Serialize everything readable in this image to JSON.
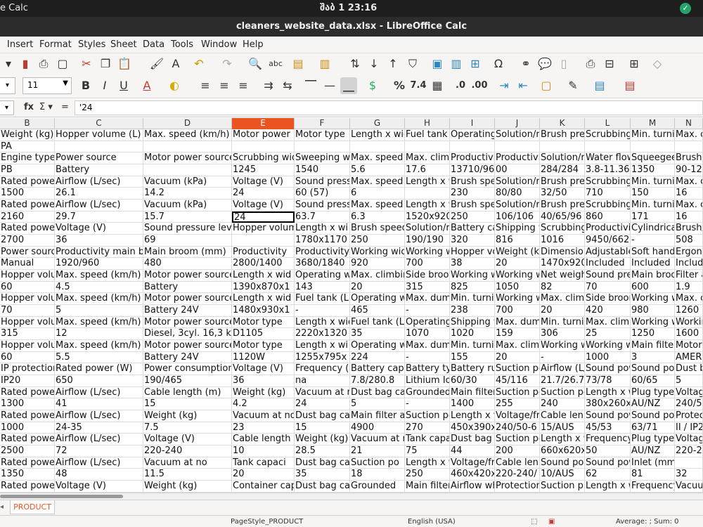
{
  "system": {
    "app_name": "e Calc",
    "clock": "შაბ 1  23:16"
  },
  "window": {
    "title": "cleaners_website_data.xlsx - LibreOffice Calc"
  },
  "menu": [
    "Insert",
    "Format",
    "Styles",
    "Sheet",
    "Data",
    "Tools",
    "Window",
    "Help"
  ],
  "toolbar": {
    "font_size": "11"
  },
  "formula": {
    "content": "'24"
  },
  "columns": [
    "B",
    "C",
    "D",
    "E",
    "F",
    "G",
    "H",
    "I",
    "J",
    "K",
    "L",
    "M",
    "N"
  ],
  "active_column": "E",
  "rows": [
    [
      "Weight (kg)",
      "Hopper volume (L)",
      "Max. speed (km/h)",
      "Motor power (",
      "Motor type",
      "Length x wid",
      "Fuel tank (L",
      "Operating w",
      "Solution/re",
      "Brush press",
      "Scrubbing w",
      "Min. turnin",
      "Max. c"
    ],
    [
      "PA",
      "",
      "",
      "",
      "",
      "",
      "",
      "",
      "",
      "",
      "",
      "",
      ""
    ],
    [
      "Engine type",
      "Power source",
      "Motor power source",
      "Scrubbing wid",
      "Sweeping wi",
      "Max. speed (",
      "Max. climb",
      "Productivity",
      "Productivity",
      "Solution/re",
      "Water flow",
      "Squeegee w",
      "Brush"
    ],
    [
      "PB",
      "Battery",
      "",
      "1245",
      "1540",
      "5.6",
      "17.6",
      "13710/9600",
      "00",
      "284/284",
      "3.8-11.36",
      "1350",
      "90-12"
    ],
    [
      "Rated power",
      "Airflow (L/sec)",
      "Vacuum (kPa)",
      "Voltage (V)",
      "Sound pressu",
      "Max. speed (",
      "Length x w",
      "Brush spe",
      "Solution/re",
      "Brush pre",
      "Scrubbing",
      "Min. turnin",
      "Max. c"
    ],
    [
      "1500",
      "26.1",
      "14.2",
      "24",
      "60 (57)",
      "6",
      "",
      "230",
      "80/80",
      "32/50",
      "710",
      "150",
      "16"
    ],
    [
      "Rated power",
      "Airflow (L/sec)",
      "Vacuum (kPa)",
      "Voltage (V)",
      "Sound pressu",
      "Max. speed (",
      "Length x w",
      "Brush spe",
      "Solution/re",
      "Brush pre",
      "Scrubbing",
      "Min. turnin",
      "Max. c"
    ],
    [
      "2160",
      "29.7",
      "15.7",
      "24",
      "63.7",
      "6.3",
      "1520x920",
      "250",
      "106/106",
      "40/65/96",
      "860",
      "171",
      "16"
    ],
    [
      "Rated power",
      "Voltage (V)",
      "Sound pressure lev",
      "Hopper volum",
      "Length x wi",
      "Brush speed",
      "Solution/re",
      "Battery cap",
      "Shipping w",
      "Scrubbing",
      "Productivity",
      "Cylindrical",
      "Brush/"
    ],
    [
      "2700",
      "36",
      "69",
      "",
      "1780x1170",
      "250",
      "190/190",
      "320",
      "816",
      "1016",
      "9450/6620",
      "-",
      "508"
    ],
    [
      "Power source",
      "Productivity main b",
      "Main broom (mm)",
      "Productivity",
      "Productivity",
      "Working wid",
      "Working w",
      "Hopper vo",
      "Weight (kg",
      "Dimension",
      "Adjustable",
      "Soft hand",
      "Ergon"
    ],
    [
      "Manual",
      "1920/960",
      "480",
      "2800/1400",
      "3680/1840",
      "920",
      "700",
      "38",
      "20",
      "1470x920",
      "Included",
      "Included",
      "Includ"
    ],
    [
      "Hopper volu",
      "Max. speed (km/h)",
      "Motor power source",
      "Length x wid",
      "Operating w",
      "Max. climbin",
      "Side broo",
      "Working w",
      "Working w",
      "Net weight",
      "Sound pres",
      "Main broo",
      "Filter a"
    ],
    [
      "60",
      "4.5",
      "Battery",
      "1390x870x1",
      "143",
      "20",
      "315",
      "825",
      "1050",
      "82",
      "70",
      "600",
      "1.9"
    ],
    [
      "Hopper volu",
      "Max. speed (km/h)",
      "Motor power source",
      "Length x wid",
      "Fuel tank (L",
      "Operating w",
      "Max. dum",
      "Min. turnin",
      "Working w",
      "Max. climb",
      "Side broom",
      "Working w",
      "Max. c"
    ],
    [
      "70",
      "5",
      "Battery 24V",
      "1480x930x1",
      "-",
      "465",
      "-",
      "238",
      "700",
      "20",
      "420",
      "980",
      "1260"
    ],
    [
      "Hopper volu",
      "Max. speed (km/h)",
      "Motor power source",
      "Motor type",
      "Length x wid",
      "Fuel tank (L",
      "Operating",
      "Shipping w",
      "Max. dum",
      "Min. turnin",
      "Max. climb",
      "Working w",
      "Workin"
    ],
    [
      "315",
      "12",
      "Diesel, 3cyl. 16,3 k",
      "D1105",
      "2220x1320",
      "35",
      "1070",
      "1020",
      "159",
      "306",
      "25",
      "1250",
      "1600"
    ],
    [
      "Hopper volu",
      "Max. speed (km/h)",
      "Motor power source",
      "Motor type",
      "Length x wi",
      "Operating w",
      "Max. dum",
      "Min. turnin",
      "Max. climb",
      "Working w",
      "Working w",
      "Main filter",
      "Motor"
    ],
    [
      "60",
      "5.5",
      "Battery 24V",
      "1120W",
      "1255x795x",
      "224",
      "-",
      "155",
      "20",
      "-",
      "1000",
      "3",
      "AMER"
    ],
    [
      "IP protection",
      "Rated power (W)",
      "Power consumption",
      "Voltage (V)",
      "Frequency (",
      "Battery cap",
      "Battery ty",
      "Battery run",
      "Suction po",
      "Airflow (L/",
      "Sound pow",
      "Sound pow",
      "Dust b"
    ],
    [
      "IP20",
      "650",
      "190/465",
      "36",
      "na",
      "7.8/280.8",
      "Lithium Io",
      "60/30",
      "45/116",
      "21.7/26.7",
      "73/78",
      "60/65",
      "5"
    ],
    [
      "Rated power",
      "Airflow (L/sec)",
      "Cable length (m)",
      "Weight (kg)",
      "Vacuum at n",
      "Dust bag ca",
      "Grounded",
      "Main filter",
      "Suction po",
      "Suction po",
      "Length x w",
      "Plug type",
      "Voltag"
    ],
    [
      "1300",
      "41",
      "15",
      "4.2",
      "24",
      "5",
      "-",
      "1400",
      "255",
      "240",
      "380x260x",
      "AU/NZ",
      "240/5"
    ],
    [
      "Rated power",
      "Airflow (L/sec)",
      "Weight (kg)",
      "Vacuum at no",
      "Dust bag ca",
      "Main filter a",
      "Suction po",
      "Length x w",
      "Voltage/fr",
      "Cable len",
      "Sound pow",
      "Sound pow",
      "Protec"
    ],
    [
      "1000",
      "24-35",
      "7.5",
      "23",
      "15",
      "4900",
      "270",
      "450x390x",
      "240/50-6",
      "15/AUS",
      "45/53",
      "63/71",
      "II / IP2"
    ],
    [
      "Rated power",
      "Airflow (L/sec)",
      "Voltage (V)",
      "Cable length",
      "Weight (kg)",
      "Vacuum at n",
      "Tank capa",
      "Dust bag",
      "Suction po",
      "Length x w",
      "Frequency",
      "Plug type",
      "Voltag"
    ],
    [
      "2500",
      "72",
      "220-240",
      "10",
      "28.5",
      "21",
      "75",
      "44",
      "200",
      "660x620x",
      "50",
      "AU/NZ",
      "220-2"
    ],
    [
      "Rated power",
      "Airflow (L/sec)",
      "Vacuum at no",
      "Tank capaci",
      "Dust bag ca",
      "Suction po",
      "Length x w",
      "Voltage/fr",
      "Cable len",
      "Sound pow",
      "Sound pow",
      "Inlet (mm",
      ""
    ],
    [
      "1350",
      "48",
      "11.5",
      "20",
      "35",
      "18",
      "250",
      "460x420x",
      "220-240/",
      "10/AUS",
      "62",
      "81",
      "32"
    ],
    [
      "Rated power",
      "Voltage (V)",
      "Weight (kg)",
      "Container cap",
      "Dust bag ca",
      "Grounded",
      "Main filter",
      "Airflow wh",
      "Protection",
      "Suction p",
      "Length x w",
      "Frequency",
      "Vacuu"
    ]
  ],
  "selected_cell": {
    "row": 7,
    "col": 3
  },
  "sheet_tabs": [
    "PRODUCT"
  ],
  "status": {
    "page_style": "PageStyle_PRODUCT",
    "language": "English (USA)",
    "summary": "Average: ; Sum: 0"
  }
}
